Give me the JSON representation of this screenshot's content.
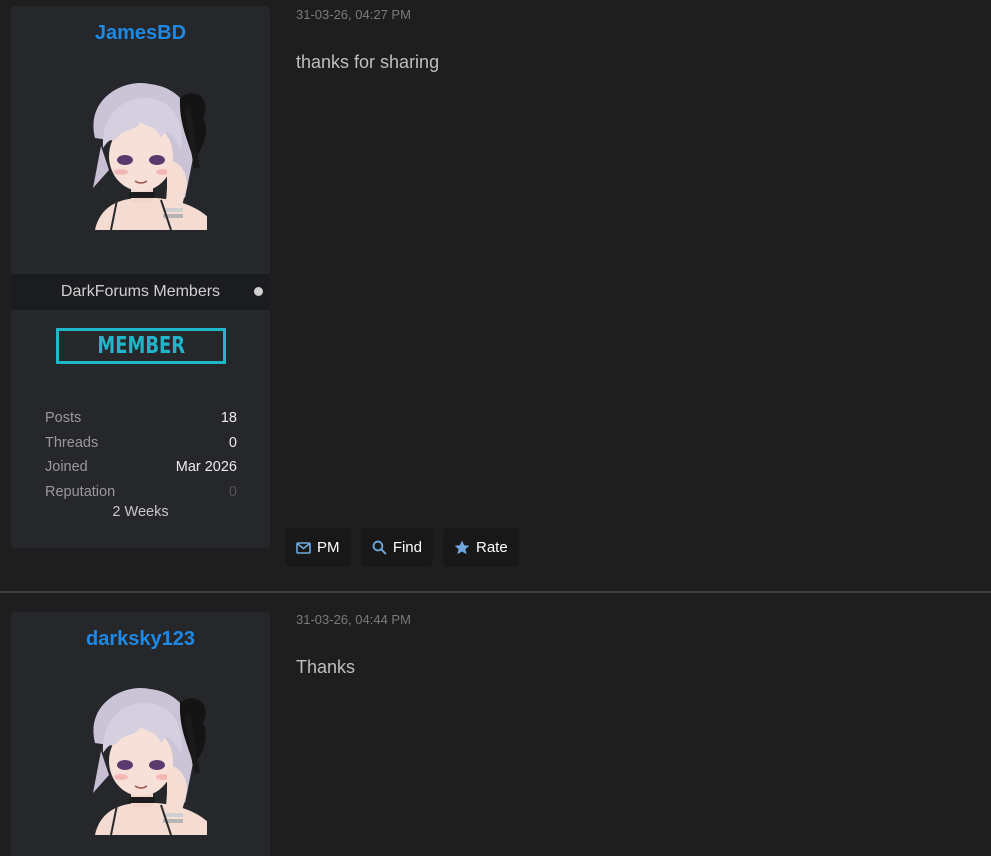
{
  "posts": [
    {
      "username": "JamesBD",
      "group": "DarkForums Members",
      "badge": "MEMBER",
      "stats": [
        {
          "label": "Posts",
          "value": "18"
        },
        {
          "label": "Threads",
          "value": "0"
        },
        {
          "label": "Joined",
          "value": "Mar 2026"
        },
        {
          "label": "Reputation",
          "value": "0"
        }
      ],
      "active_time": "2 Weeks",
      "date": "31-03-26, 04:27 PM",
      "message": "thanks for sharing",
      "actions": {
        "pm": "PM",
        "find": "Find",
        "rate": "Rate"
      }
    },
    {
      "username": "darksky123",
      "date": "31-03-26, 04:44 PM",
      "message": "Thanks"
    }
  ],
  "colors": {
    "username": "#1e88e5",
    "badge": "#1fb6c9",
    "icon": "#6fa8dc",
    "background": "#1e1e1e",
    "card": "#25272b"
  },
  "icons": {
    "pm": "envelope-icon",
    "find": "search-icon",
    "rate": "star-icon",
    "status": "online-status-dot"
  }
}
